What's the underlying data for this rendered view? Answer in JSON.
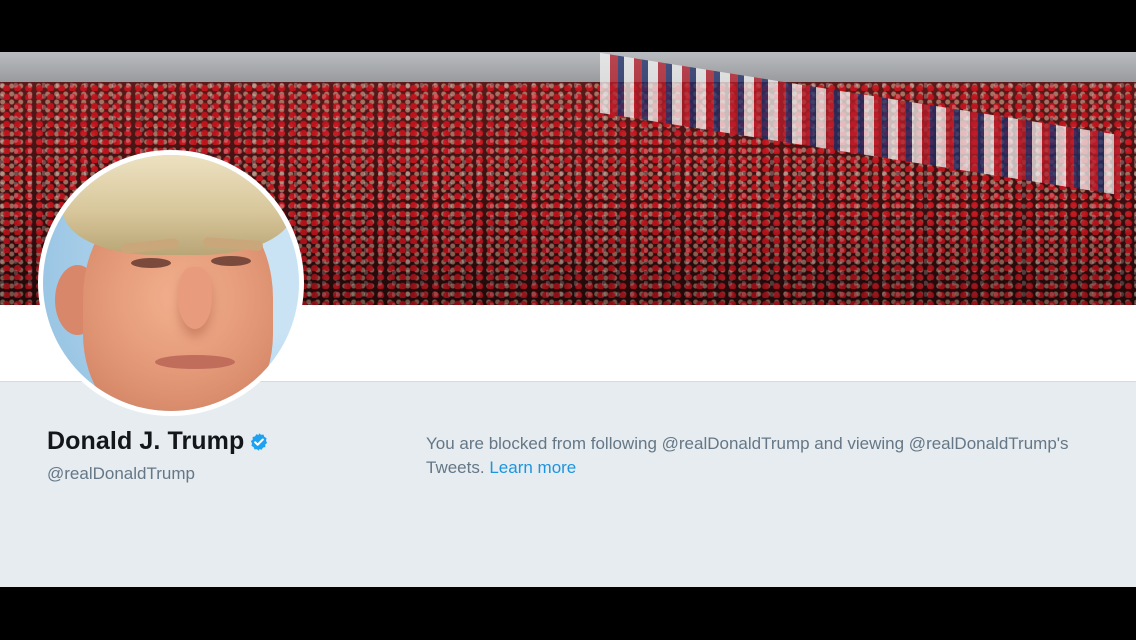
{
  "profile": {
    "name": "Donald J. Trump",
    "handle": "@realDonaldTrump",
    "verified_badge_color": "#1da1f2"
  },
  "blocked_notice": {
    "message": "You are blocked from following @realDonaldTrump and viewing @realDonaldTrump's Tweets.",
    "learn_more": "Learn more"
  },
  "colors": {
    "background": "#e6ecf0",
    "link": "#1b95e0",
    "secondary_text": "#657786",
    "primary_text": "#14171a"
  },
  "icons": {
    "verified": "verified-check-icon"
  }
}
